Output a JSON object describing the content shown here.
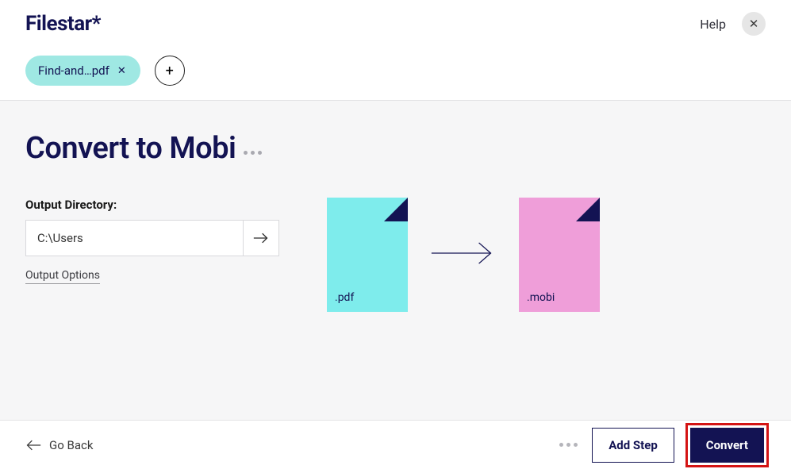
{
  "header": {
    "logo": "Filestar*",
    "help_label": "Help"
  },
  "chips": {
    "file_label": "Find-and…pdf"
  },
  "main": {
    "title": "Convert to Mobi",
    "output_dir_label": "Output Directory:",
    "output_dir_value": "C:\\Users",
    "output_options_label": "Output Options"
  },
  "viz": {
    "from_ext": ".pdf",
    "to_ext": ".mobi"
  },
  "footer": {
    "go_back_label": "Go Back",
    "add_step_label": "Add Step",
    "convert_label": "Convert"
  }
}
